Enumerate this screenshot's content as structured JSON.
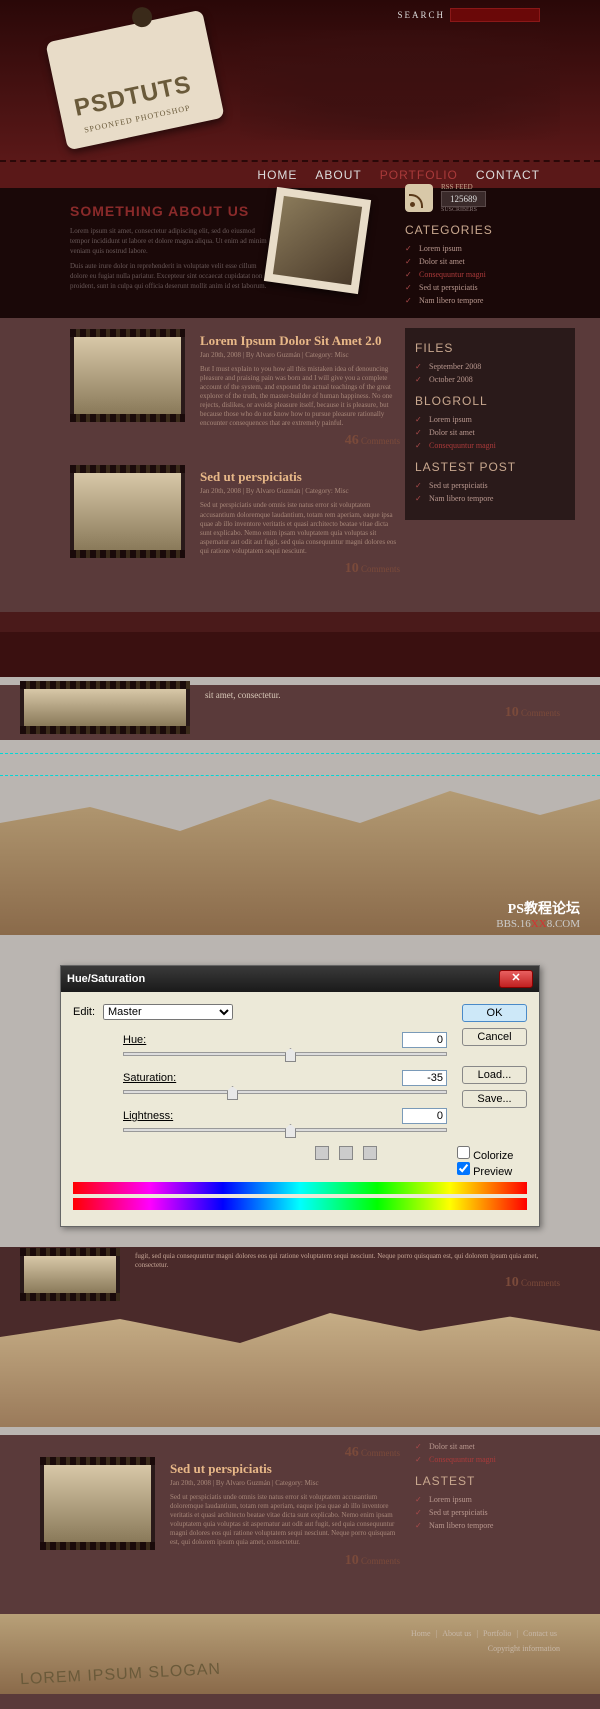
{
  "section1": {
    "tag_title": "PSDTUTS",
    "tag_sub": "SPOONFED PHOTOSHOP",
    "search_label": "SEARCH",
    "nav": [
      {
        "label": "HOME",
        "active": false
      },
      {
        "label": "ABOUT",
        "active": false
      },
      {
        "label": "PORTFOLIO",
        "active": true
      },
      {
        "label": "CONTACT",
        "active": false
      }
    ],
    "about_heading": "SOMETHING ABOUT US",
    "about_p1": "Lorem ipsum sit amet, consectetur adipiscing elit, sed do eiusmod tempor incididunt ut labore et dolore magna aliqua. Ut enim ad minim veniam quis nostrud labore.",
    "about_p2": "Duis aute irure dolor in reprehenderit in voluptate velit esse cillum dolore eu fugiat nulla pariatur. Excepteur sint occaecat cupidatat non proident, sunt in culpa qui officia deserunt mollit anim id est laborum.",
    "rss_label": "RSS FEED",
    "rss_count": "125689",
    "rss_sub": "SUSCRIBERS",
    "categories_h": "CATEGORIES",
    "categories": [
      {
        "label": "Lorem ipsum",
        "red": false
      },
      {
        "label": "Dolor sit amet",
        "red": false
      },
      {
        "label": "Consequuntur magni",
        "red": true
      },
      {
        "label": "Sed ut perspiciatis",
        "red": false
      },
      {
        "label": "Nam libero tempore",
        "red": false
      }
    ],
    "files_h": "FILES",
    "files": [
      "September 2008",
      "October 2008"
    ],
    "blogroll_h": "BLOGROLL",
    "blogroll": [
      {
        "label": "Lorem ipsum",
        "red": false
      },
      {
        "label": "Dolor sit amet",
        "red": false
      },
      {
        "label": "Consequuntur magni",
        "red": true
      }
    ],
    "latest_h": "LASTEST POST",
    "latest": [
      "Sed ut perspiciatis",
      "Nam libero tempore"
    ],
    "post1": {
      "title": "Lorem Ipsum Dolor Sit Amet 2.0",
      "meta": "Jan 20th, 2008 | By Alvaro Guzmán | Category: Misc",
      "body": "But I must explain to you how all this mistaken idea of denouncing pleasure and praising pain was born and I will give you a complete account of the system, and expound the actual teachings of the great explorer of the truth, the master-builder of human happiness. No one rejects, dislikes, or avoids pleasure itself, because it is pleasure, but because those who do not know how to pursue pleasure rationally encounter consequences that are extremely painful.",
      "comments_n": "46",
      "comments_lbl": "Comments"
    },
    "post2": {
      "title": "Sed ut perspiciatis",
      "meta": "Jan 20th, 2008 | By Alvaro Guzmán | Category: Misc",
      "body": "Sed ut perspiciatis unde omnis iste natus error sit voluptatem accusantium doloremque laudantium, totam rem aperiam, eaque ipsa quae ab illo inventore veritatis et quasi architecto beatae vitae dicta sunt explicabo. Nemo enim ipsam voluptatem quia voluptas sit aspernatur aut odit aut fugit, sed quia consequuntur magni dolores eos qui ratione voluptatem sequi nesciunt.",
      "comments_n": "10",
      "comments_lbl": "Comments"
    }
  },
  "section2": {
    "frag_text": "sit amet, consectetur.",
    "comments_n": "10",
    "comments_lbl": "Comments",
    "watermark1": "PS教程论坛",
    "watermark2_a": "BBS.16",
    "watermark2_b": "XX",
    "watermark2_c": "8.COM"
  },
  "dialog": {
    "title": "Hue/Saturation",
    "edit_label": "Edit:",
    "edit_value": "Master",
    "hue_label": "Hue:",
    "hue_value": "0",
    "sat_label": "Saturation:",
    "sat_value": "-35",
    "light_label": "Lightness:",
    "light_value": "0",
    "ok": "OK",
    "cancel": "Cancel",
    "load": "Load...",
    "save": "Save...",
    "colorize": "Colorize",
    "preview": "Preview"
  },
  "section4": {
    "frag_body": "fugit, sed quia consequuntur magni dolores eos qui ratione voluptatem sequi nesciunt. Neque porro quisquam est, qui dolorem ipsum quia amet, consectetur.",
    "comments_n": "10",
    "comments_lbl": "Comments"
  },
  "section5": {
    "top_comments_n": "46",
    "top_comments_lbl": "Comments",
    "side_items": [
      {
        "label": "Dolor sit amet",
        "red": false
      },
      {
        "label": "Consequuntur magni",
        "red": true
      }
    ],
    "lastest_h": "LASTEST",
    "lastest": [
      "Lorem ipsum",
      "Sed ut perspiciatis",
      "Nam libero tempore"
    ],
    "post": {
      "title": "Sed ut perspiciatis",
      "meta": "Jan 20th, 2008 | By Alvaro Guzmán | Category: Misc",
      "body": "Sed ut perspiciatis unde omnis iste natus error sit voluptatem accusantium doloremque laudantium, totam rem aperiam, eaque ipsa quae ab illo inventore veritatis et quasi architecto beatae vitae dicta sunt explicabo. Nemo enim ipsam voluptatem quia voluptas sit aspernatur aut odit aut fugit, sed quia consequuntur magni dolores eos qui ratione voluptatem sequi nesciunt. Neque porro quisquam est, qui dolorem ipsum quia amet, consectetur.",
      "comments_n": "10",
      "comments_lbl": "Comments"
    },
    "slogan": "LOREM IPSUM SLOGAN",
    "foot_links": [
      "Home",
      "About us",
      "Portfolio",
      "Contact us"
    ],
    "copyright": "Copyright information"
  }
}
